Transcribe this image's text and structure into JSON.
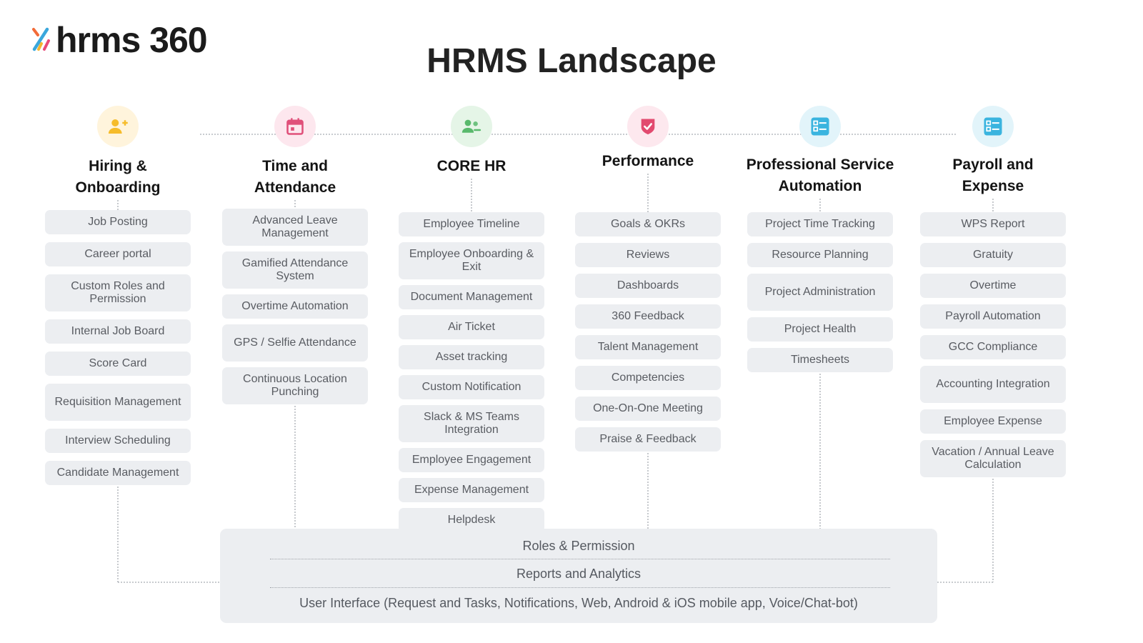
{
  "logo": {
    "text": "hrms 360"
  },
  "title": "HRMS Landscape",
  "columns": [
    {
      "title": "Hiring &\nOnboarding",
      "icon": "user-add-icon",
      "icon_color": "#f6bc2a",
      "icon_bg": "#fff4dc",
      "items": [
        "Job Posting",
        "Career portal",
        "Custom Roles and Permission",
        "Internal Job Board",
        "Score Card",
        "Requisition Management",
        "Interview Scheduling",
        "Candidate Management"
      ]
    },
    {
      "title": "Time and\nAttendance",
      "icon": "calendar-icon",
      "icon_color": "#e0507a",
      "icon_bg": "#fde7ee",
      "items": [
        "Advanced Leave Management",
        "Gamified Attendance System",
        "Overtime Automation",
        "GPS / Selfie Attendance",
        "Continuous Location Punching"
      ]
    },
    {
      "title": "CORE HR",
      "icon": "users-icon",
      "icon_color": "#59b96c",
      "icon_bg": "#e5f5e7",
      "items": [
        "Employee Timeline",
        "Employee Onboarding & Exit",
        "Document Management",
        "Air Ticket",
        "Asset tracking",
        "Custom Notification",
        "Slack & MS Teams Integration",
        "Employee Engagement",
        "Expense Management",
        "Helpdesk"
      ]
    },
    {
      "title": "Performance",
      "icon": "shield-check-icon",
      "icon_color": "#e24a6f",
      "icon_bg": "#fde8ee",
      "items": [
        "Goals & OKRs",
        "Reviews",
        "Dashboards",
        "360 Feedback",
        "Talent Management",
        "Competencies",
        "One-On-One Meeting",
        "Praise & Feedback"
      ]
    },
    {
      "title": "Professional Service\nAutomation",
      "icon": "list-board-icon",
      "icon_color": "#3ab4df",
      "icon_bg": "#e2f4fa",
      "items": [
        "Project Time Tracking",
        "Resource Planning",
        "Project Administration",
        "Project Health",
        "Timesheets"
      ]
    },
    {
      "title": "Payroll and\nExpense",
      "icon": "list-board-icon",
      "icon_color": "#3ab4df",
      "icon_bg": "#e2f4fa",
      "items": [
        "WPS Report",
        "Gratuity",
        "Overtime",
        "Payroll Automation",
        "GCC Compliance",
        "Accounting Integration",
        "Employee Expense",
        "Vacation / Annual Leave Calculation"
      ]
    }
  ],
  "platform": [
    "Roles & Permission",
    "Reports and Analytics",
    "User Interface (Request and Tasks, Notifications, Web, Android & iOS mobile app, Voice/Chat-bot)"
  ]
}
